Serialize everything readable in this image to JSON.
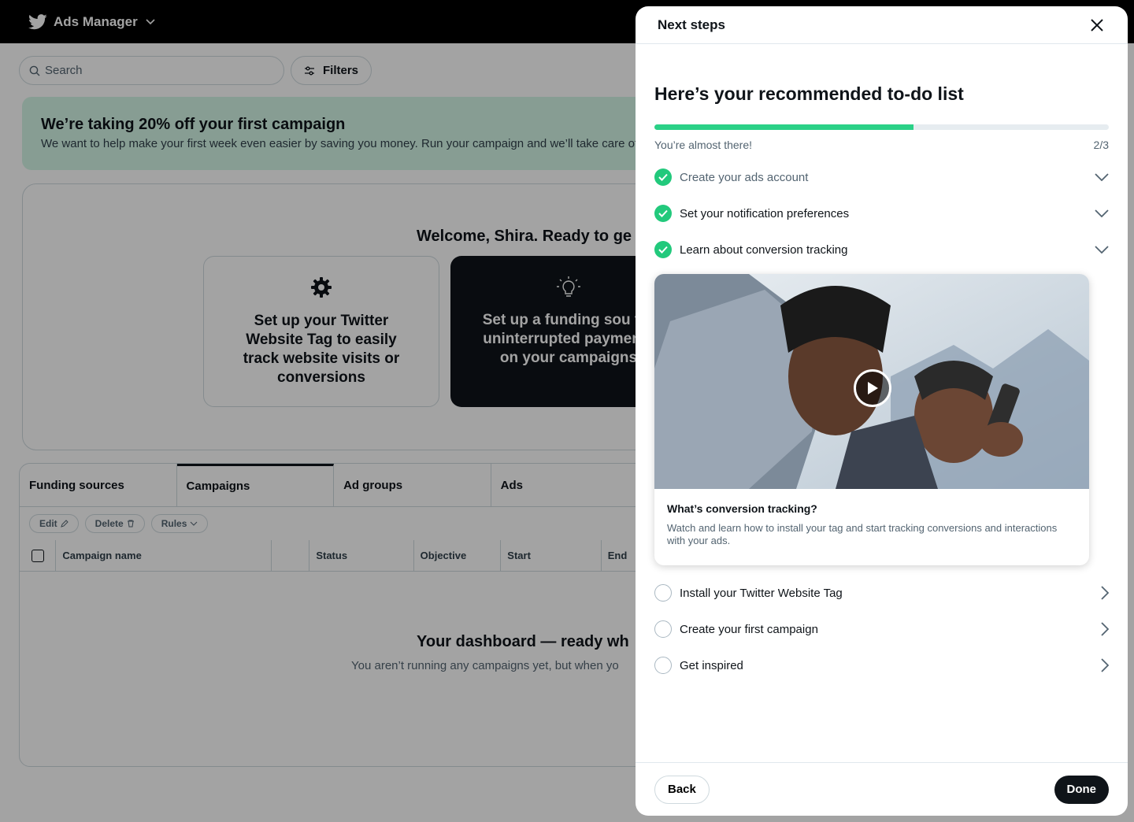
{
  "app": {
    "title": "Ads Manager",
    "search_placeholder": "Search",
    "filters_label": "Filters",
    "promo": {
      "title": "We’re taking 20% off your first campaign",
      "body": "We want to help make your first week even easier by saving you money. Run your campaign and we’ll take care of"
    },
    "welcome": {
      "title": "Welcome, Shira. Ready to ge",
      "card1": "Set up your Twitter Website Tag to easily track website visits or conversions",
      "card2": "Set up a funding sou for uninterrupted payments on your campaigns"
    },
    "tabs": [
      "Funding sources",
      "Campaigns",
      "Ad groups",
      "Ads"
    ],
    "actions": [
      "Edit",
      "Delete",
      "Rules"
    ],
    "columns": [
      "Campaign name",
      "Status",
      "Objective",
      "Start",
      "End"
    ],
    "empty": {
      "title": "Your dashboard — ready wh",
      "body": "You aren’t running any campaigns yet, but when yo"
    }
  },
  "panel": {
    "title": "Next steps",
    "heading": "Here’s your recommended to-do list",
    "progress_fraction": 0.57,
    "progress_text": "You’re almost there!",
    "progress_count": "2/3",
    "completed": [
      {
        "label": "Create your ads account"
      },
      {
        "label": "Set your notification preferences"
      },
      {
        "label": "Learn about conversion tracking"
      }
    ],
    "video": {
      "title": "What’s conversion tracking?",
      "description": "Watch and learn how to install your tag and start tracking conversions and interactions with your ads."
    },
    "pending": [
      {
        "label": "Install your Twitter Website Tag"
      },
      {
        "label": "Create your first campaign"
      },
      {
        "label": "Get inspired"
      }
    ],
    "back_label": "Back",
    "done_label": "Done"
  },
  "colors": {
    "accent_green": "#22c97c",
    "progress_green": "#2bd187",
    "promo_bg": "#d4f6e6",
    "dark": "#0f1419"
  }
}
